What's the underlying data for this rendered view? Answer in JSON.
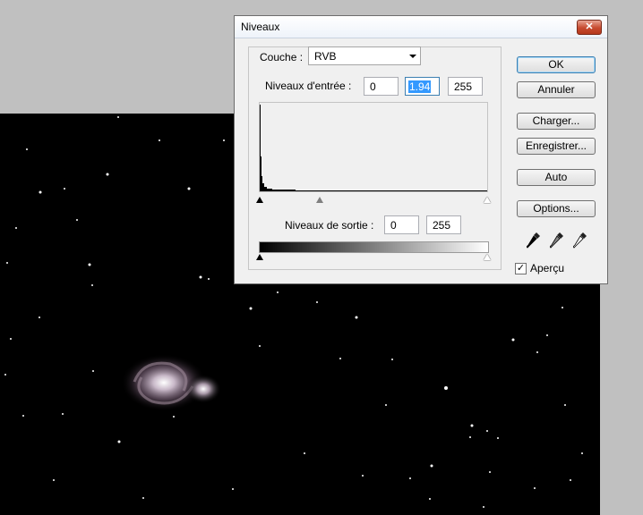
{
  "dialog": {
    "title": "Niveaux",
    "close_icon": "close-icon"
  },
  "channel": {
    "label": "Couche :",
    "value": "RVB"
  },
  "input_levels": {
    "label": "Niveaux d'entrée :",
    "black": "0",
    "gamma": "1.94",
    "white": "255"
  },
  "output_levels": {
    "label": "Niveaux de sortie :",
    "black": "0",
    "white": "255"
  },
  "buttons": {
    "ok": "OK",
    "cancel": "Annuler",
    "load": "Charger...",
    "save": "Enregistrer...",
    "auto": "Auto",
    "options": "Options..."
  },
  "eyedroppers": [
    "black-eyedropper-icon",
    "gray-eyedropper-icon",
    "white-eyedropper-icon"
  ],
  "preview": {
    "label": "Aperçu",
    "checked": true
  }
}
